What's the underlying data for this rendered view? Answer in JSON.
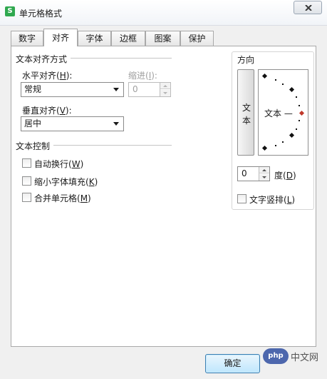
{
  "window": {
    "title": "单元格格式"
  },
  "tabs": [
    "数字",
    "对齐",
    "字体",
    "边框",
    "图案",
    "保护"
  ],
  "active_tab": "对齐",
  "text_alignment": {
    "group_title": "文本对齐方式",
    "horizontal": {
      "label": "水平对齐(",
      "hotkey": "H",
      "suffix": "):",
      "value": "常规"
    },
    "indent": {
      "label": "缩进(",
      "hotkey": "I",
      "suffix": "):",
      "value": "0"
    },
    "vertical": {
      "label": "垂直对齐(",
      "hotkey": "V",
      "suffix": "):",
      "value": "居中"
    }
  },
  "text_control": {
    "group_title": "文本控制",
    "wrap": {
      "label": "自动换行(",
      "hotkey": "W",
      "suffix": ")",
      "checked": false
    },
    "shrink": {
      "label": "缩小字体填充(",
      "hotkey": "K",
      "suffix": ")",
      "checked": false
    },
    "merge": {
      "label": "合并单元格(",
      "hotkey": "M",
      "suffix": ")",
      "checked": false
    }
  },
  "orientation": {
    "title": "方向",
    "vertical_text_chars": [
      "文",
      "本"
    ],
    "dial_text": "文本 —",
    "degrees_value": "0",
    "degrees_label": "度(",
    "degrees_hotkey": "D",
    "degrees_suffix": ")",
    "vertical_layout": {
      "label": "文字竖排(",
      "hotkey": "L",
      "suffix": ")",
      "checked": false
    },
    "marker_color": "#c0392b"
  },
  "buttons": {
    "ok": "确定"
  },
  "watermark": {
    "logo": "php",
    "text": "中文网"
  }
}
